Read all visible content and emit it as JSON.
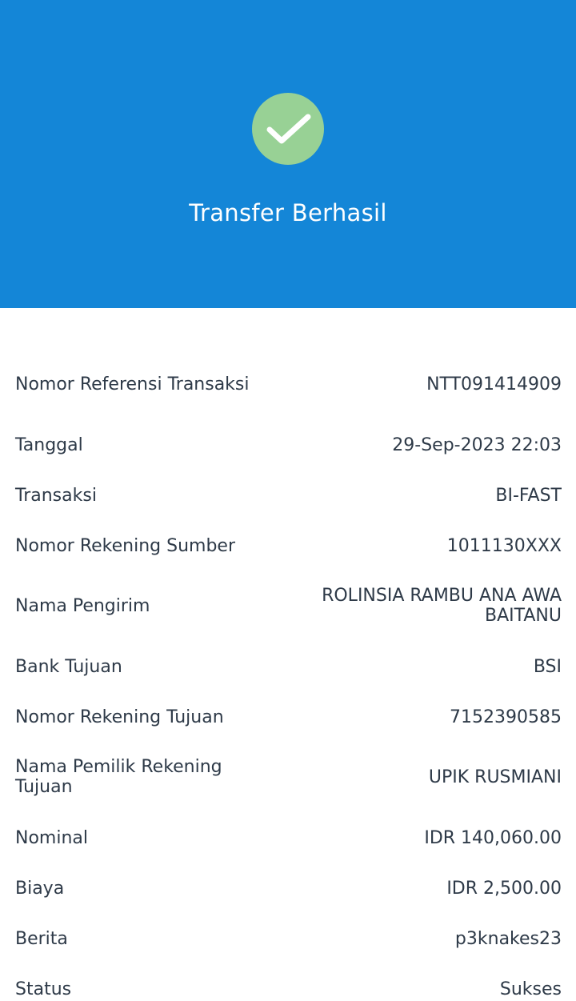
{
  "header": {
    "title": "Transfer Berhasil",
    "background_color": "#1486d7",
    "icon": "checkmark-circle-icon",
    "icon_color": "#98d195"
  },
  "details": [
    {
      "label": "Nomor Referensi Transaksi",
      "value": "NTT091414909"
    },
    {
      "label": "Tanggal",
      "value": "29-Sep-2023 22:03"
    },
    {
      "label": "Transaksi",
      "value": "BI-FAST"
    },
    {
      "label": "Nomor Rekening Sumber",
      "value": "1011130XXX"
    },
    {
      "label": "Nama Pengirim",
      "value": "ROLINSIA RAMBU ANA AWA BAITANU"
    },
    {
      "label": "Bank Tujuan",
      "value": "BSI"
    },
    {
      "label": "Nomor Rekening Tujuan",
      "value": "7152390585"
    },
    {
      "label": "Nama Pemilik Rekening Tujuan",
      "value": "UPIK RUSMIANI"
    },
    {
      "label": "Nominal",
      "value": "IDR 140,060.00"
    },
    {
      "label": "Biaya",
      "value": "IDR 2,500.00"
    },
    {
      "label": "Berita",
      "value": "p3knakes23"
    },
    {
      "label": "Status",
      "value": "Sukses"
    }
  ]
}
